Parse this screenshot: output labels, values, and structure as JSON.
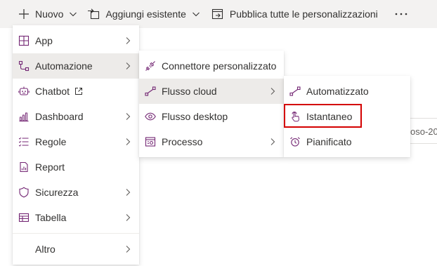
{
  "toolbar": {
    "new_label": "Nuovo",
    "add_existing_label": "Aggiungi esistente",
    "publish_label": "Pubblica tutte le personalizzazioni",
    "more_icon": "more-horizontal-icon"
  },
  "background": {
    "partial_text": "oso-20"
  },
  "menu_main": {
    "items": [
      {
        "label": "App",
        "icon": "app-grid-icon"
      },
      {
        "label": "Automazione",
        "icon": "automation-icon"
      },
      {
        "label": "Chatbot",
        "icon": "chatbot-icon"
      },
      {
        "label": "Dashboard",
        "icon": "dashboard-icon"
      },
      {
        "label": "Regole",
        "icon": "rules-icon"
      },
      {
        "label": "Report",
        "icon": "report-icon"
      },
      {
        "label": "Sicurezza",
        "icon": "shield-icon"
      },
      {
        "label": "Tabella",
        "icon": "table-icon"
      },
      {
        "label": "Altro",
        "icon": ""
      }
    ]
  },
  "menu_automation": {
    "items": [
      {
        "label": "Connettore personalizzato",
        "icon": "connector-icon"
      },
      {
        "label": "Flusso cloud",
        "icon": "cloud-flow-icon"
      },
      {
        "label": "Flusso desktop",
        "icon": "desktop-flow-icon"
      },
      {
        "label": "Processo",
        "icon": "process-icon"
      }
    ]
  },
  "menu_cloudflow": {
    "items": [
      {
        "label": "Automatizzato",
        "icon": "automated-flow-icon"
      },
      {
        "label": "Istantaneo",
        "icon": "touch-icon"
      },
      {
        "label": "Pianificato",
        "icon": "alarm-clock-icon"
      }
    ]
  },
  "colors": {
    "accent": "#742774",
    "selected_bg": "#edebe9",
    "highlight": "#d40000"
  }
}
